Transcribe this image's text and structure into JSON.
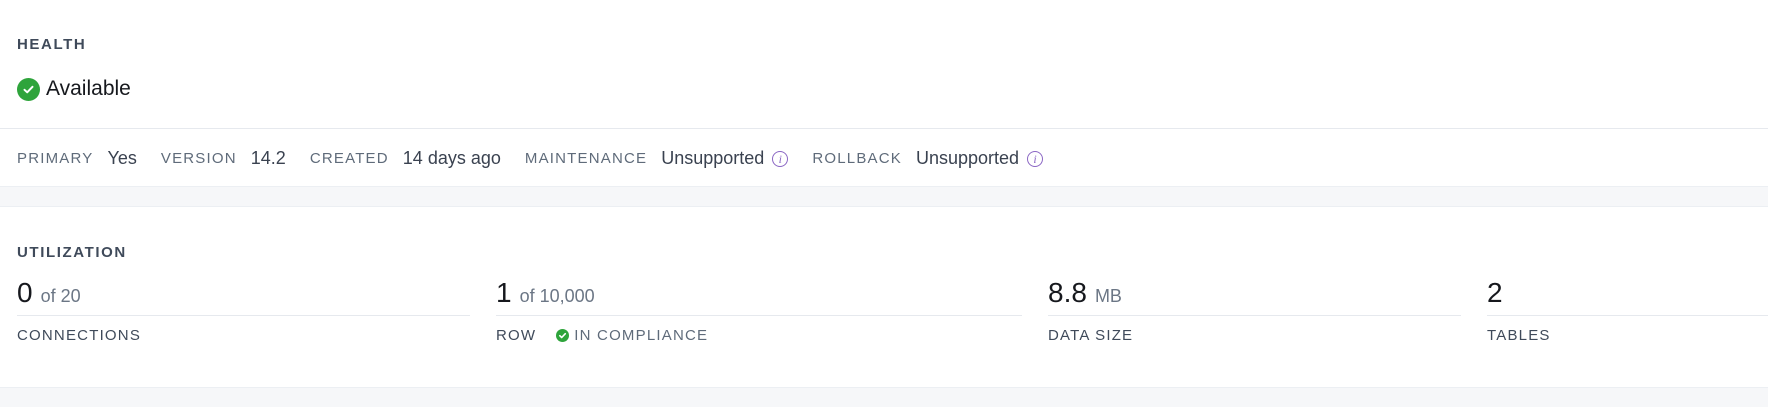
{
  "health": {
    "label": "HEALTH",
    "status": "Available",
    "status_icon": "check-circle-icon",
    "status_color": "#2ea43b"
  },
  "meta": {
    "primary_key": "PRIMARY",
    "primary_val": "Yes",
    "version_key": "VERSION",
    "version_val": "14.2",
    "created_key": "CREATED",
    "created_val": "14 days ago",
    "maintenance_key": "MAINTENANCE",
    "maintenance_val": "Unsupported",
    "rollback_key": "ROLLBACK",
    "rollback_val": "Unsupported",
    "info_icon": "info-icon",
    "info_icon_glyph": "i",
    "info_color": "#8b67c4"
  },
  "utilization": {
    "label": "UTILIZATION",
    "connections": {
      "value": "0",
      "sub": "of 20",
      "caption": "CONNECTIONS"
    },
    "rows": {
      "value": "1",
      "sub": "of 10,000",
      "caption": "ROW",
      "compliance": "IN COMPLIANCE"
    },
    "data_size": {
      "value": "8.8",
      "sub": "MB",
      "caption": "DATA SIZE"
    },
    "tables": {
      "value": "2",
      "sub": "",
      "caption": "TABLES"
    }
  }
}
